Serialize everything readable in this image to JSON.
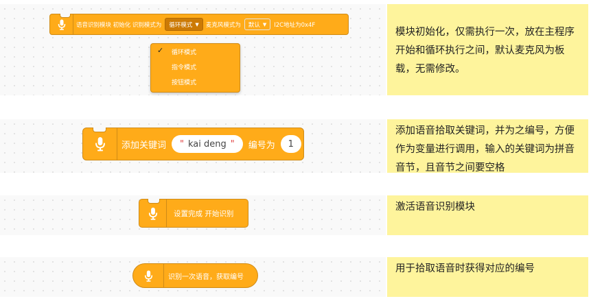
{
  "block1": {
    "label1": "语音识别模块 初始化 识别模式为",
    "mode": "循环模式",
    "label2": "麦克风模式为",
    "mic": "默认",
    "label3": "I2C地址为0x4F",
    "menu": [
      "循环模式",
      "指令模式",
      "按钮模式"
    ],
    "note": "模块初始化，仅需执行一次，放在主程序开始和循环执行之间，默认麦克风为板载，无需修改。"
  },
  "block2": {
    "label1": "添加关键词",
    "keyword": "kai deng",
    "label2": "编号为",
    "number": "1",
    "note": "添加语音拾取关键词，并为之编号，方便作为变量进行调用，输入的关键词为拼音音节，且音节之间要空格"
  },
  "block3": {
    "label": "设置完成 开始识别",
    "note": "激活语音识别模块"
  },
  "block4": {
    "label": "识别一次语音，获取编号",
    "note": "用于拾取语音时获得对应的编号"
  },
  "colors": {
    "block": "#ffab19",
    "dropdown": "#cc7a05",
    "note_bg": "#fef49c"
  },
  "icons": {
    "block_icon": "microphone-icon",
    "selected": "checkmark-icon",
    "dropdown": "caret-down-icon"
  }
}
